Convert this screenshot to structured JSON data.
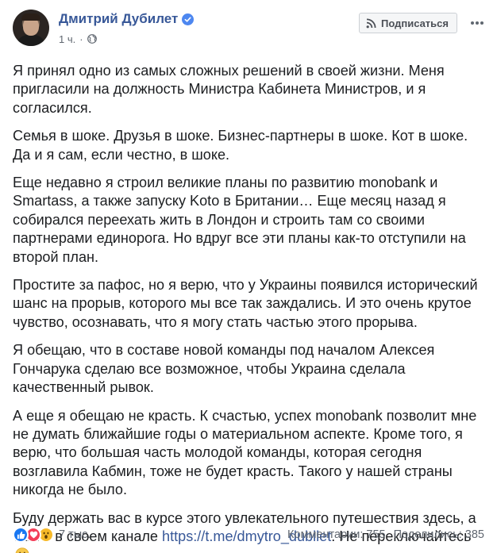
{
  "header": {
    "author_name": "Дмитрий Дубилет",
    "time": "1 ч.",
    "meta_separator": "·",
    "subscribe_label": "Подписаться"
  },
  "post": {
    "paragraphs": [
      "Я принял одно из самых сложных решений в своей жизни. Меня пригласили на должность Министра Кабинета Министров, и я согласился.",
      "Семья в шоке. Друзья в шоке. Бизнес-партнеры в шоке. Кот в шоке. Да и я сам, если честно, в шоке.",
      "Еще недавно я строил великие планы по развитию monobank и Smartass, а также запуску Koto в Британии… Еще месяц назад я собирался переехать жить в Лондон и строить там со своими партнерами единорога. Но вдруг все эти планы как-то отступили на второй план.",
      "Простите за пафос, но я верю, что у Украины появился исторический шанс на прорыв, которого мы все так заждались. И это очень крутое чувство, осознавать, что я могу стать частью этого прорыва.",
      "Я обещаю, что в составе новой команды под началом Алексея Гончарука сделаю все возможное, чтобы Украина сделала качественный рывок.",
      "А еще я обещаю не красть. К счастью, успех monobank позволит мне не думать ближайшие годы о материальном аспекте. Кроме того, я верю, что большая часть молодой команды, которая сегодня возглавила Кабмин, тоже не будет красть. Такого у нашей страны никогда не было."
    ],
    "last_paragraph_before": "Буду держать вас в курсе этого увлекательного путешествия здесь, а также в своем канале ",
    "link_text": "https://t.me/dmytro_dubilet",
    "last_paragraph_after": ". Не переключайтесь"
  },
  "footer": {
    "reactions_count": "7 тыс.",
    "comments": "Комментарии: 755",
    "shares": "Поделились: 385"
  },
  "colors": {
    "name_blue": "#385898",
    "like_blue": "#1877f2",
    "love_red": "#f33e58",
    "wow_yellow": "#f7b928"
  },
  "icons": [
    "verified-badge-icon",
    "globe-icon",
    "rss-icon",
    "more-options-icon",
    "like-icon",
    "love-icon",
    "wow-icon",
    "smile-emoji-icon"
  ]
}
